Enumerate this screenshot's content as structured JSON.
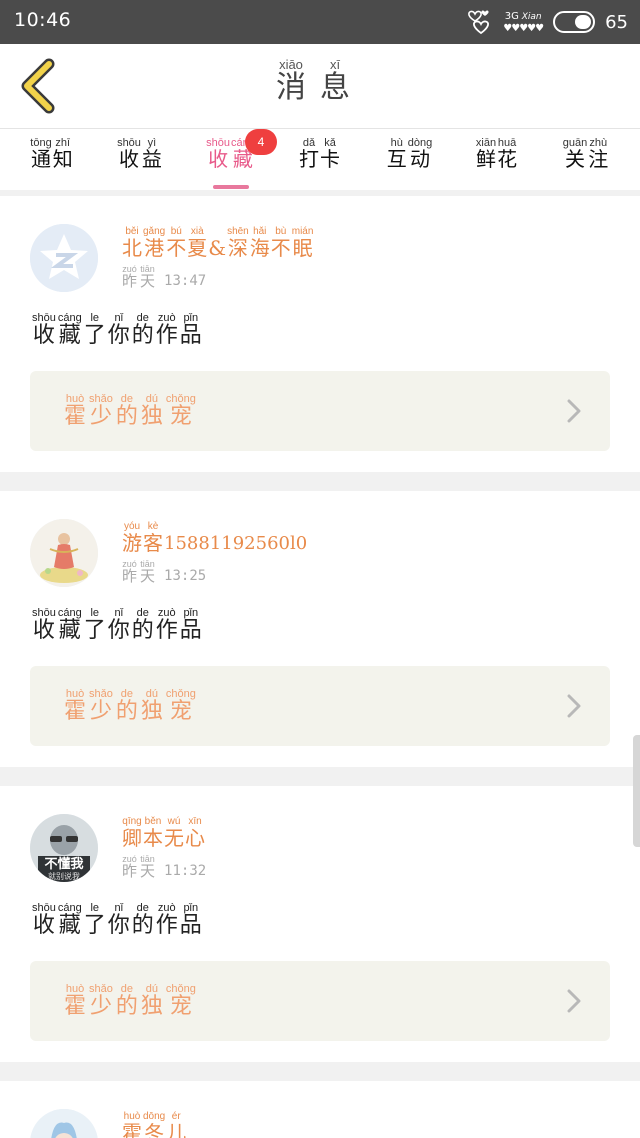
{
  "status_bar": {
    "time": "10:46",
    "network": "3G",
    "signal_hearts": "♥♥♥♥♥",
    "battery": "65",
    "icons": [
      "heart-cluster-icon",
      "signal-icon",
      "toggle-icon"
    ]
  },
  "header": {
    "title": [
      {
        "py": "xiāo",
        "hz": "消"
      },
      {
        "py": "xī",
        "hz": "息"
      }
    ],
    "back_icon": "back-chevron-icon",
    "accent_color": "#e8c341"
  },
  "tabs": [
    {
      "chars": [
        {
          "py": "tōng",
          "hz": "通"
        },
        {
          "py": "zhī",
          "hz": "知"
        }
      ],
      "active": false
    },
    {
      "chars": [
        {
          "py": "shōu",
          "hz": "收"
        },
        {
          "py": "yì",
          "hz": "益"
        }
      ],
      "active": false
    },
    {
      "chars": [
        {
          "py": "shōu",
          "hz": "收"
        },
        {
          "py": "cáng",
          "hz": "藏"
        }
      ],
      "active": true,
      "badge": "4"
    },
    {
      "chars": [
        {
          "py": "dǎ",
          "hz": "打"
        },
        {
          "py": "kǎ",
          "hz": "卡"
        }
      ],
      "active": false
    },
    {
      "chars": [
        {
          "py": "hù",
          "hz": "互"
        },
        {
          "py": "dòng",
          "hz": "动"
        }
      ],
      "active": false
    },
    {
      "chars": [
        {
          "py": "xiān",
          "hz": "鲜"
        },
        {
          "py": "huā",
          "hz": "花"
        }
      ],
      "active": false
    },
    {
      "chars": [
        {
          "py": "guān",
          "hz": "关"
        },
        {
          "py": "zhù",
          "hz": "注"
        }
      ],
      "active": false
    }
  ],
  "colors": {
    "active_tab": "#e85a8a",
    "badge": "#ef3f3f",
    "username": "#e88a4a",
    "work_title": "#f0a070",
    "work_box": "#f3f3ec"
  },
  "cards": [
    {
      "user": [
        {
          "py": "běi",
          "hz": "北"
        },
        {
          "py": "gǎng",
          "hz": "港"
        },
        {
          "py": "bú",
          "hz": "不"
        },
        {
          "py": "xià",
          "hz": "夏"
        },
        {
          "py": "",
          "hz": "&"
        },
        {
          "py": "shēn",
          "hz": "深"
        },
        {
          "py": "hǎi",
          "hz": "海"
        },
        {
          "py": "bù",
          "hz": "不"
        },
        {
          "py": "mián",
          "hz": "眠"
        }
      ],
      "date": [
        {
          "py": "zuó",
          "hz": "昨"
        },
        {
          "py": "tiān",
          "hz": "天"
        }
      ],
      "time": "13:47",
      "action": [
        {
          "py": "shōu",
          "hz": "收"
        },
        {
          "py": "cáng",
          "hz": "藏"
        },
        {
          "py": "le",
          "hz": "了"
        },
        {
          "py": "nǐ",
          "hz": "你"
        },
        {
          "py": "de",
          "hz": "的"
        },
        {
          "py": "zuò",
          "hz": "作"
        },
        {
          "py": "pǐn",
          "hz": "品"
        }
      ],
      "work": [
        {
          "py": "huò",
          "hz": "霍"
        },
        {
          "py": "shǎo",
          "hz": "少"
        },
        {
          "py": "de",
          "hz": "的"
        },
        {
          "py": "dú",
          "hz": "独"
        },
        {
          "py": "chǒng",
          "hz": "宠"
        }
      ],
      "avatar_icon": "qzone-star-icon"
    },
    {
      "user": [
        {
          "py": "yóu",
          "hz": "游"
        },
        {
          "py": "kè",
          "hz": "客"
        }
      ],
      "user_suffix": "15881192560l0",
      "date": [
        {
          "py": "zuó",
          "hz": "昨"
        },
        {
          "py": "tiān",
          "hz": "天"
        }
      ],
      "time": "13:25",
      "action": [
        {
          "py": "shōu",
          "hz": "收"
        },
        {
          "py": "cáng",
          "hz": "藏"
        },
        {
          "py": "le",
          "hz": "了"
        },
        {
          "py": "nǐ",
          "hz": "你"
        },
        {
          "py": "de",
          "hz": "的"
        },
        {
          "py": "zuò",
          "hz": "作"
        },
        {
          "py": "pǐn",
          "hz": "品"
        }
      ],
      "work": [
        {
          "py": "huò",
          "hz": "霍"
        },
        {
          "py": "shǎo",
          "hz": "少"
        },
        {
          "py": "de",
          "hz": "的"
        },
        {
          "py": "dú",
          "hz": "独"
        },
        {
          "py": "chǒng",
          "hz": "宠"
        }
      ],
      "avatar_icon": "dancer-avatar-icon"
    },
    {
      "user": [
        {
          "py": "qīng",
          "hz": "卿"
        },
        {
          "py": "běn",
          "hz": "本"
        },
        {
          "py": "wú",
          "hz": "无"
        },
        {
          "py": "xīn",
          "hz": "心"
        }
      ],
      "date": [
        {
          "py": "zuó",
          "hz": "昨"
        },
        {
          "py": "tiān",
          "hz": "天"
        }
      ],
      "time": "11:32",
      "action": [
        {
          "py": "shōu",
          "hz": "收"
        },
        {
          "py": "cáng",
          "hz": "藏"
        },
        {
          "py": "le",
          "hz": "了"
        },
        {
          "py": "nǐ",
          "hz": "你"
        },
        {
          "py": "de",
          "hz": "的"
        },
        {
          "py": "zuò",
          "hz": "作"
        },
        {
          "py": "pǐn",
          "hz": "品"
        }
      ],
      "work": [
        {
          "py": "huò",
          "hz": "霍"
        },
        {
          "py": "shǎo",
          "hz": "少"
        },
        {
          "py": "de",
          "hz": "的"
        },
        {
          "py": "dú",
          "hz": "独"
        },
        {
          "py": "chǒng",
          "hz": "宠"
        }
      ],
      "avatar_text": "不懂我",
      "avatar_subtext": "就别说我",
      "avatar_icon": "photo-avatar-icon"
    },
    {
      "user": [
        {
          "py": "huò",
          "hz": "霍"
        },
        {
          "py": "dōng",
          "hz": "冬"
        },
        {
          "py": "ér",
          "hz": "儿"
        }
      ],
      "avatar_icon": "anime-avatar-icon"
    }
  ]
}
